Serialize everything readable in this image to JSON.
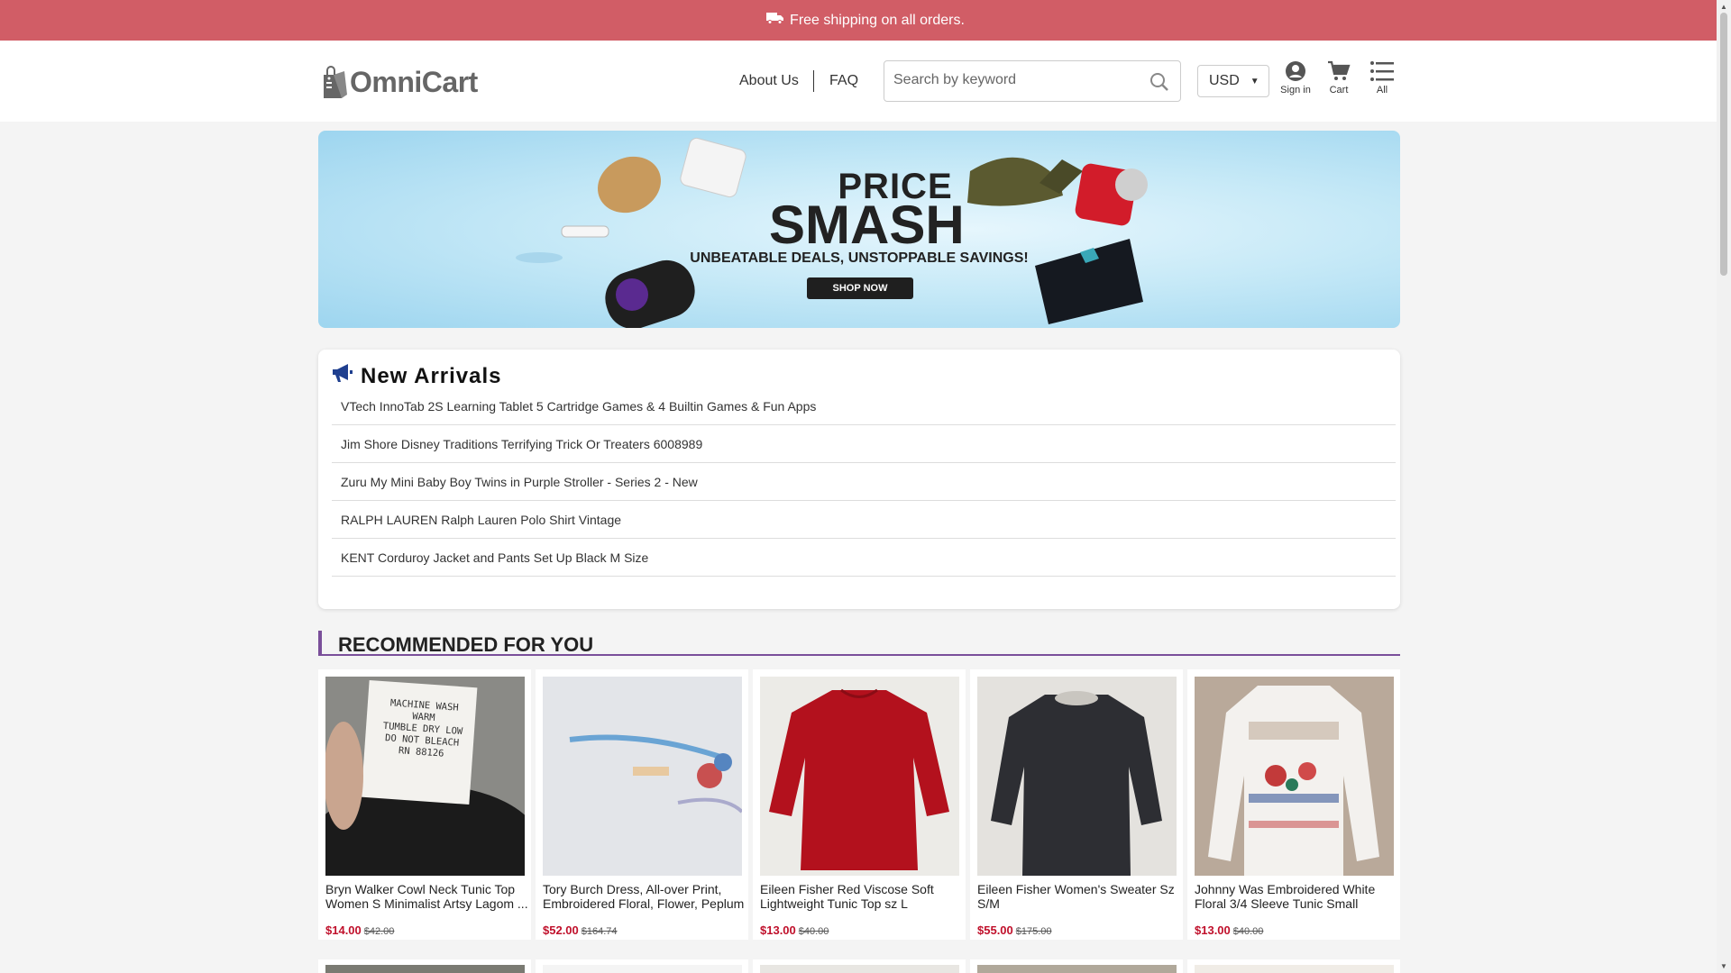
{
  "announcement": {
    "text": "Free shipping on all orders.",
    "icon": "truck-icon"
  },
  "header": {
    "brand": "OmniCart",
    "nav": [
      {
        "label": "About Us"
      },
      {
        "label": "FAQ"
      }
    ],
    "search": {
      "placeholder": "Search by keyword",
      "value": ""
    },
    "currency": {
      "selected": "USD"
    },
    "icons": [
      {
        "label": "Sign in",
        "icon": "user-icon"
      },
      {
        "label": "Cart",
        "icon": "cart-icon"
      },
      {
        "label": "All",
        "icon": "menu-icon"
      }
    ]
  },
  "banner": {
    "title_line1": "PRICE",
    "title_line2": "SMASH",
    "tagline": "UNBEATABLE DEALS, UNSTOPPABLE SAVINGS!",
    "cta": "SHOP NOW"
  },
  "new_arrivals": {
    "title": "New Arrivals",
    "items": [
      "VTech InnoTab 2S Learning Tablet 5 Cartridge Games & 4 Builtin Games & Fun Apps",
      "Jim Shore Disney Traditions Terrifying Trick Or Treaters 6008989",
      "Zuru My Mini Baby Boy Twins in Purple Stroller - Series 2 - New",
      "RALPH LAUREN Ralph Lauren Polo Shirt Vintage",
      "KENT Corduroy Jacket and Pants Set Up Black M Size"
    ]
  },
  "recommended": {
    "title": "RECOMMENDED FOR YOU",
    "products": [
      {
        "title": "Bryn Walker Cowl Neck Tunic Top Women S Minimalist Artsy Lagom ...",
        "price": "$14.00",
        "was": "$42.00"
      },
      {
        "title": "Tory Burch Dress, All-over Print, Embroidered Floral, Flower, Peplum",
        "price": "$52.00",
        "was": "$164.74"
      },
      {
        "title": "Eileen Fisher Red Viscose Soft Lightweight Tunic Top sz L",
        "price": "$13.00",
        "was": "$40.00"
      },
      {
        "title": "Eileen Fisher Women's Sweater Sz S/M",
        "price": "$55.00",
        "was": "$175.00"
      },
      {
        "title": "Johnny Was Embroidered White Floral 3/4 Sleeve Tunic Small",
        "price": "$13.00",
        "was": "$40.00"
      }
    ],
    "label_texts": [
      "MACHINE WASH",
      "WARM",
      "TUMBLE DRY LOW",
      "DO NOT BLEACH",
      "RN 88126"
    ]
  },
  "colors": {
    "announce": "#d15d66",
    "accent": "#7a4f9a",
    "price": "#c0102b"
  }
}
